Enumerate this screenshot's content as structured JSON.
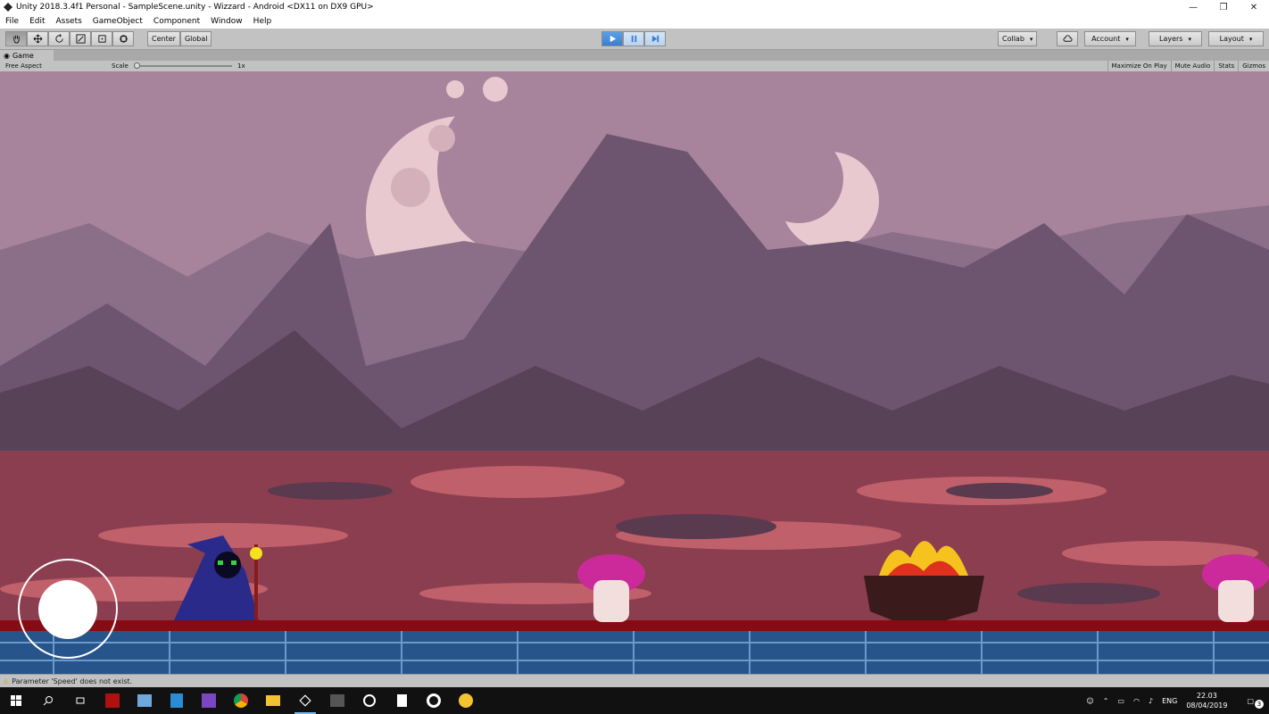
{
  "window": {
    "title": "Unity 2018.3.4f1 Personal - SampleScene.unity - Wizzard - Android <DX11 on DX9 GPU>",
    "controls": [
      "—",
      "❐",
      "✕"
    ]
  },
  "menu": [
    "File",
    "Edit",
    "Assets",
    "GameObject",
    "Component",
    "Window",
    "Help"
  ],
  "toolbar": {
    "pivot_label": "Center",
    "space_label": "Global",
    "collab_label": "Collab",
    "account_label": "Account",
    "layers_label": "Layers",
    "layout_label": "Layout"
  },
  "game_view": {
    "tab_label": "Game",
    "aspect_label": "Free Aspect",
    "scale_label": "Scale",
    "scale_value": "1x",
    "maximize_label": "Maximize On Play",
    "mute_label": "Mute Audio",
    "stats_label": "Stats",
    "gizmos_label": "Gizmos"
  },
  "status": {
    "message": "Parameter 'Speed' does not exist."
  },
  "taskbar": {
    "language": "ENG",
    "time": "22.03",
    "date": "08/04/2019",
    "notifications": "3"
  },
  "colors": {
    "sky": "#a7849b",
    "moon": "#e7c9cf",
    "mountain_far": "#8b6f89",
    "mountain_mid": "#6d5570",
    "mountain_near": "#584258",
    "ground_red": "#8a3e50",
    "ground_pink": "#c0606a",
    "floor_blue": "#27548a",
    "blood": "#8a0a12",
    "wizard": "#2a2a8a",
    "mushroom_cap": "#cc2a9a",
    "fire": "#f5c21e",
    "accent_play": "#3a7fd0"
  }
}
